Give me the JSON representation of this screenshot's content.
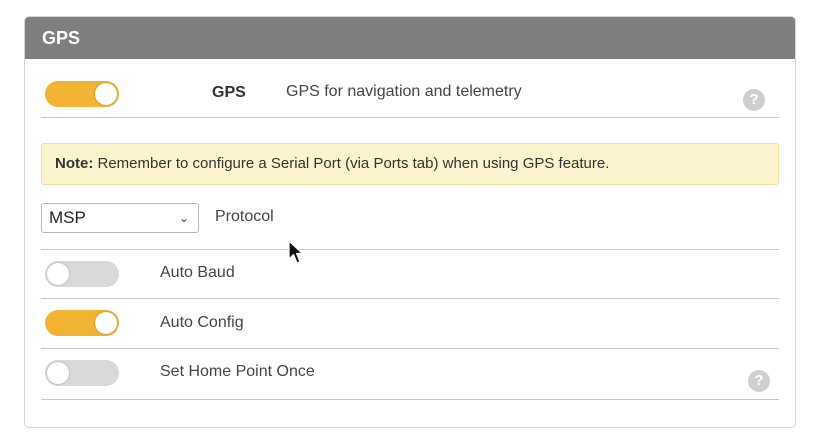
{
  "panel": {
    "title": "GPS"
  },
  "gps_feature": {
    "toggle_state": "on",
    "name": "GPS",
    "description": "GPS for navigation and telemetry",
    "help": "?"
  },
  "note": {
    "prefix": "Note:",
    "text": " Remember to configure a Serial Port (via Ports tab) when using GPS feature."
  },
  "protocol": {
    "selected": "MSP",
    "label": "Protocol"
  },
  "settings": [
    {
      "label": "Auto Baud",
      "state": "off"
    },
    {
      "label": "Auto Config",
      "state": "on"
    },
    {
      "label": "Set Home Point Once",
      "state": "off"
    }
  ],
  "home_help": "?",
  "colors": {
    "accent": "#f2b233",
    "header": "#7f7f7f",
    "note_bg": "#fcf4cf"
  }
}
